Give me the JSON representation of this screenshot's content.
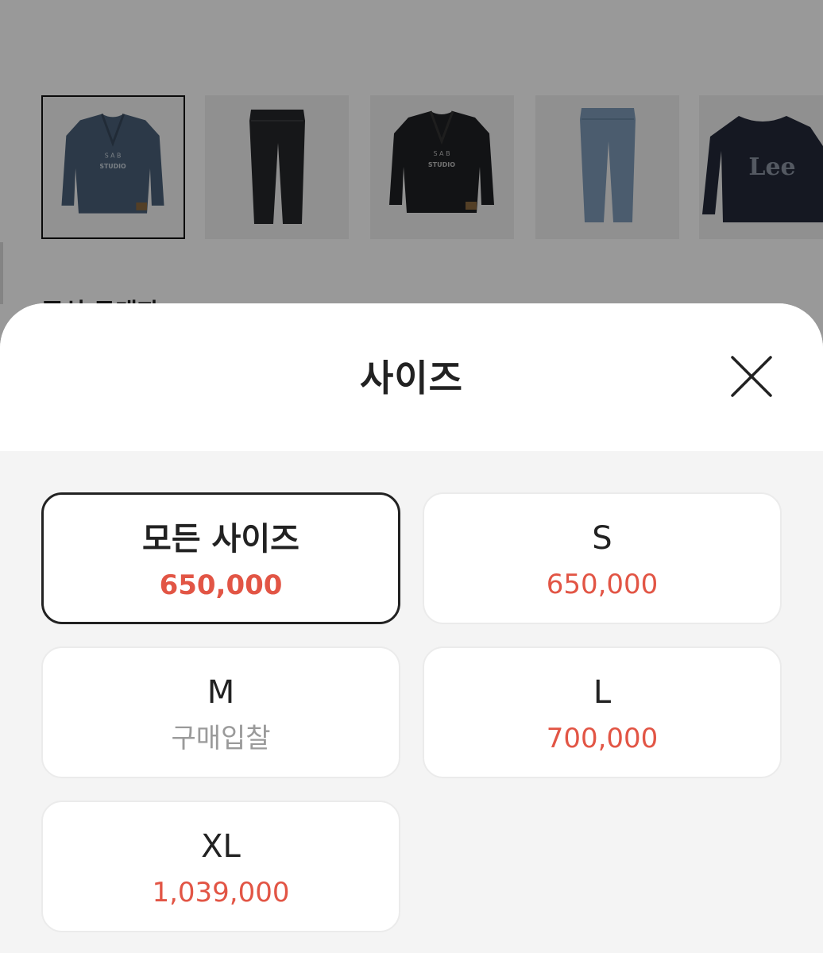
{
  "background": {
    "caption": "주식 구매자",
    "products": [
      {
        "icon": "denim-jacket-icon",
        "selected": true
      },
      {
        "icon": "black-jeans-icon",
        "selected": false
      },
      {
        "icon": "black-jacket-icon",
        "selected": false
      },
      {
        "icon": "blue-jeans-icon",
        "selected": false
      },
      {
        "icon": "lee-sweatshirt-icon",
        "selected": false
      }
    ]
  },
  "sheet": {
    "title": "사이즈",
    "close_icon": "close-icon"
  },
  "sizes": [
    {
      "label": "모든 사이즈",
      "price": "650,000",
      "selected": true
    },
    {
      "label": "S",
      "price": "650,000",
      "selected": false
    },
    {
      "label": "M",
      "price": "구매입찰",
      "selected": false
    },
    {
      "label": "L",
      "price": "700,000",
      "selected": false
    },
    {
      "label": "XL",
      "price": "1,039,000",
      "selected": false
    }
  ],
  "colors": {
    "price": "#e25545",
    "bid_text": "#9a9a9a",
    "selected_border": "#222222"
  }
}
